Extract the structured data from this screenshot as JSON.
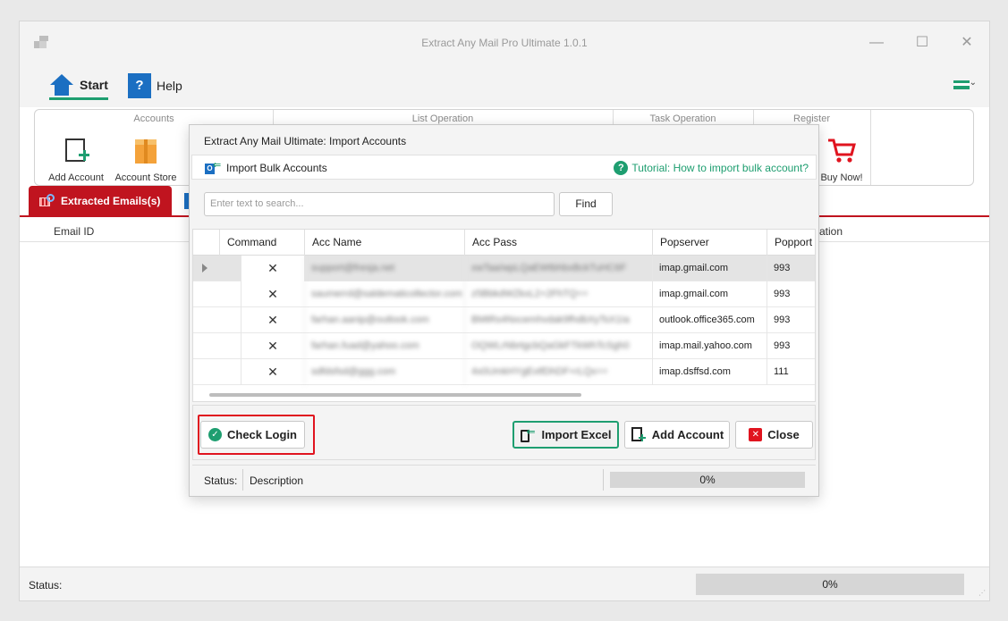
{
  "window": {
    "title": "Extract Any Mail Pro Ultimate 1.0.1"
  },
  "ribbon_tabs": [
    {
      "label": "Start"
    },
    {
      "label": "Help"
    }
  ],
  "ribbon": {
    "groups": [
      {
        "label": "Accounts"
      },
      {
        "label": "List Operation"
      },
      {
        "label": "Task Operation"
      },
      {
        "label": "Register"
      }
    ],
    "buttons": {
      "add_account": "Add Account",
      "account_store": "Account Store",
      "buy_now": "Buy Now!"
    }
  },
  "doc_tabs": {
    "active": "Extracted Emails(s)"
  },
  "grid": {
    "col_email": "Email ID",
    "col_tail": "ation"
  },
  "status": {
    "label": "Status:",
    "progress": "0%"
  },
  "dialog": {
    "title": "Extract Any Mail Ultimate: Import Accounts",
    "header": "Import Bulk Accounts",
    "tutorial": "Tutorial: How to import bulk account?",
    "search_placeholder": "Enter text to search...",
    "find": "Find",
    "columns": [
      "Command",
      "Acc Name",
      "Acc Pass",
      "Popserver",
      "Popport"
    ],
    "rows": [
      {
        "cmd": "✕",
        "name": "support@fresja.net",
        "pass": "xwTaa/wpLQaEWtbhbxBckTuHC6F",
        "server": "imap.gmail.com",
        "port": "993"
      },
      {
        "cmd": "✕",
        "name": "saumerrd@saldematicollector.com",
        "pass": "z5BbkdWZkxL2+2FhTQ==",
        "server": "imap.gmail.com",
        "port": "993"
      },
      {
        "cmd": "✕",
        "name": "farhan.aanip@outlook.com",
        "pass": "BMtRs4Nxcemhvdak9fhdbXyTsX1Ia",
        "server": "outlook.office365.com",
        "port": "993"
      },
      {
        "cmd": "✕",
        "name": "farhan.fuad@yahoo.com",
        "pass": "OQWLrNbrtgcbQaGkFTkWhTcSgh0",
        "server": "imap.mail.yahoo.com",
        "port": "993"
      },
      {
        "cmd": "✕",
        "name": "sdfdsfsd@ggg.com",
        "pass": "4x0UmkHYgEvtfDhDF+rLQx==",
        "server": "imap.dsffsd.com",
        "port": "111"
      }
    ],
    "buttons": {
      "check_login": "Check Login",
      "import_excel": "Import Excel",
      "add_account": "Add Account",
      "close": "Close"
    },
    "status": {
      "label": "Status:",
      "description": "Description",
      "progress": "0%"
    }
  },
  "colors": {
    "accent": "#1e9e70",
    "tab_red": "#c0141f",
    "highlight": "#e0141f",
    "brand_blue": "#1b6fc2"
  }
}
